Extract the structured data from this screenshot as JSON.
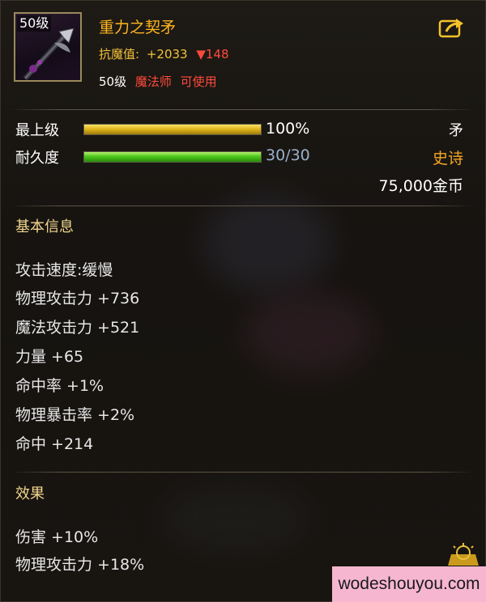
{
  "item": {
    "level_badge": "50级",
    "name": "重力之契矛",
    "resist_label": "抗魔值:",
    "resist_value": "+2033",
    "resist_diff": "▼148",
    "req_level": "50级",
    "req_class": "魔法师",
    "req_usable": "可使用",
    "icon": "spear-weapon-icon"
  },
  "bars": {
    "grade_label": "最上级",
    "grade_text": "100%",
    "grade_fraction": 1.0,
    "durability_label": "耐久度",
    "durability_text": "30/30",
    "durability_fraction": 1.0
  },
  "summary": {
    "type": "矛",
    "rarity": "史诗",
    "price": "75,000金币"
  },
  "basic_info": {
    "title": "基本信息",
    "attrs": [
      "攻击速度:缓慢",
      "物理攻击力 +736",
      "魔法攻击力 +521",
      "力量 +65",
      "命中率 +1%",
      "物理暴击率 +2%",
      "命中 +214"
    ]
  },
  "effects": {
    "title": "效果",
    "attrs": [
      "伤害 +10%",
      "物理攻击力 +18%"
    ]
  },
  "watermark": "wodeshouyou.com",
  "colors": {
    "item_name": "#ffb51e",
    "rarity": "#f6a624",
    "warning": "#ff4a3a",
    "section_title": "#f2d68e"
  }
}
